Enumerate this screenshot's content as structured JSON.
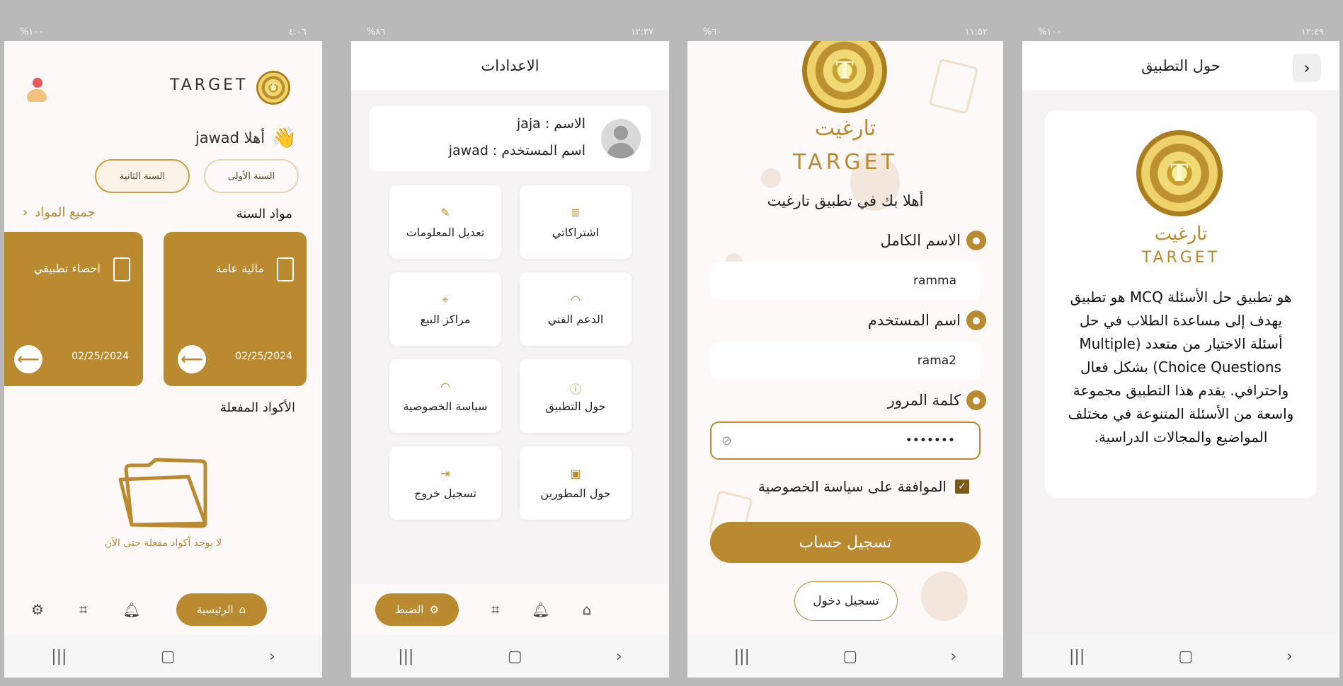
{
  "phone1": {
    "status": {
      "left": "%١٠٠",
      "right": "٤:٠٦"
    },
    "brand": "TARGET",
    "greeting": "أهلا jawad",
    "wave": "👋",
    "year_first": "السنة الأولى",
    "year_second": "السنة الثانية",
    "section_title": "مواد السنة",
    "all_subjects": "جميع المواد",
    "cards": [
      {
        "title": "مالية عامة",
        "date": "02/25/2024"
      },
      {
        "title": "احصاء تطبيقي",
        "date": "02/25/2024"
      }
    ],
    "codes_title": "الأكواد المفعلة",
    "no_codes": "لا يوجد أكواد مفعلة حتى الآن",
    "home_label": "الرئيسية"
  },
  "phone2": {
    "status": {
      "left": "%٨٦",
      "right": "١٢:٣٧"
    },
    "title": "الاعدادات",
    "name_line": "الاسم : jaja",
    "username_line": "اسم المستخدم : jawad",
    "tiles": [
      {
        "label": "اشتراكاتي",
        "icon": "≣"
      },
      {
        "label": "تعديل المعلومات",
        "icon": "✎"
      },
      {
        "label": "الدعم الفني",
        "icon": "◠"
      },
      {
        "label": "مراكز البيع",
        "icon": "⌖"
      },
      {
        "label": "حول التطبيق",
        "icon": "ⓘ"
      },
      {
        "label": "سياسة الخصوصية",
        "icon": "◠"
      },
      {
        "label": "حول المطورين",
        "icon": "▣"
      },
      {
        "label": "تسجيل خروج",
        "icon": "⇥"
      }
    ],
    "settings_label": "الضبط"
  },
  "phone3": {
    "status": {
      "left": "%٦٠",
      "right": "١١:٥٢"
    },
    "brand_ar": "تارغيت",
    "brand_en": "TARGET",
    "welcome": "أهلا بك في تطبيق تارغيت",
    "fullname_label": "الاسم الكامل",
    "fullname_value": "ramma",
    "username_label": "اسم المستخدم",
    "username_value": "rama2",
    "password_label": "كلمة المرور",
    "password_value": "•••••••",
    "agree_text": "الموافقة على  سياسة الخصوصية",
    "register_button": "تسجيل حساب",
    "login_button": "تسجيل دخول"
  },
  "phone4": {
    "status": {
      "left": "%١٠٠",
      "right": "١٢:٤٩"
    },
    "title": "حول التطبيق",
    "brand_ar": "تارغيت",
    "brand_en": "TARGET",
    "description": "هو تطبيق حل الأسئلة MCQ هو تطبيق يهدف إلى مساعدة الطلاب في حل أسئلة الاختيار من متعدد (Multiple Choice Questions) بشكل فعال واحترافي. يقدم هذا التطبيق مجموعة واسعة من الأسئلة المتنوعة في مختلف المواضيع والمجالات الدراسية."
  },
  "colors": {
    "accent": "#b98a2f",
    "background": "#fcf9f8",
    "frame": "#b9b9b9"
  }
}
